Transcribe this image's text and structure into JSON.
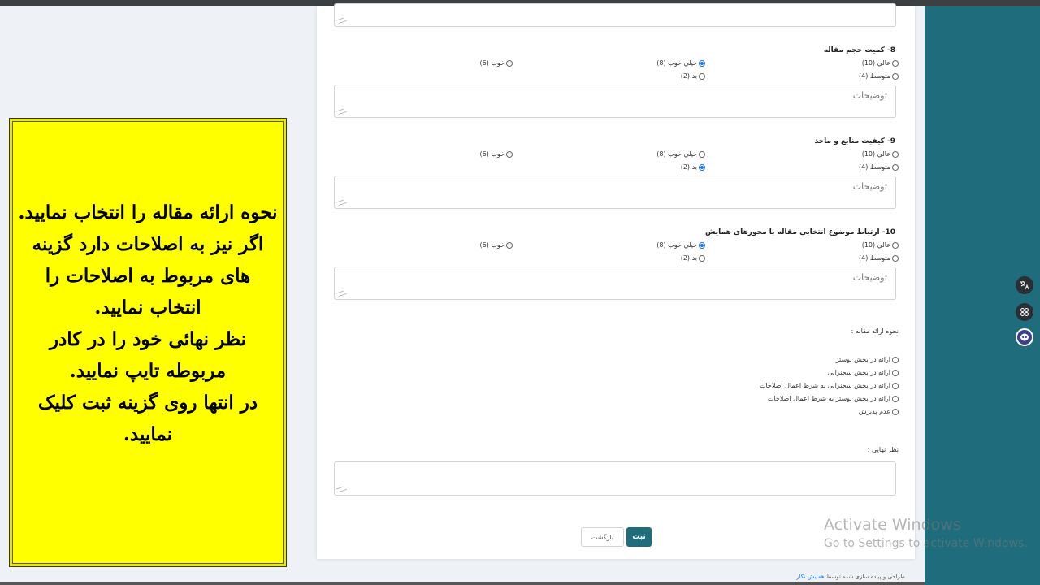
{
  "form": {
    "comments_placeholder": "توضیحات",
    "questions": [
      {
        "title": "8- کمیت حجم مقاله",
        "options": {
          "excellent": "عالي (10)",
          "very_good": "خیلي خوب (8)",
          "good": "خوب (6)",
          "average": "متوسط (4)",
          "bad": "بد (2)"
        },
        "selected": "very_good"
      },
      {
        "title": "9- کیفیت منابع و ماخذ",
        "options": {
          "excellent": "عالي (10)",
          "very_good": "خیلي خوب (8)",
          "good": "خوب (6)",
          "average": "متوسط (4)",
          "bad": "بد (2)"
        },
        "selected": "bad"
      },
      {
        "title": "10- ارتباط موضوع انتخابی مقاله با محورهای همایش",
        "options": {
          "excellent": "عالي (10)",
          "very_good": "خیلي خوب (8)",
          "good": "خوب (6)",
          "average": "متوسط (4)",
          "bad": "بد (2)"
        },
        "selected": "very_good"
      }
    ],
    "presentation": {
      "label": "نحوه ارائه مقاله :",
      "options": [
        "ارائه در بخش پوستر",
        "ارائه در بخش سخنرانی",
        "ارائه در بخش سخنرانی به شرط اعمال اصلاحات",
        "ارائه در بخش پوستر به شرط اعمال اصلاحات",
        "عدم پذیرش"
      ]
    },
    "final_opinion_label": "نظر نهایی :",
    "submit_label": "ثبت",
    "back_label": "بازگشت"
  },
  "footer": {
    "text": "طراحی و پیاده سازی شده توسط",
    "link": "همایش نگار"
  },
  "instructions": "نحوه ارائه مقاله را انتخاب نمایید.\nاگر نیز به اصلاحات دارد گزینه های مربوط به اصلاحات را انتخاب نمایید.\nنظر نهائی خود را در کادر مربوطه  تایپ نمایید.\nدر انتها روی گزینه ثبت کلیک نمایید.",
  "side_icons": [
    "translate-icon",
    "apps-grid-icon",
    "assistant-bot-icon"
  ],
  "watermark": {
    "line1": "Activate Windows",
    "line2": "Go to Settings to activate Windows."
  },
  "colors": {
    "primary": "#1e6c7c",
    "note_bg": "#ffff00",
    "radio_selected": "#1a73e8"
  }
}
